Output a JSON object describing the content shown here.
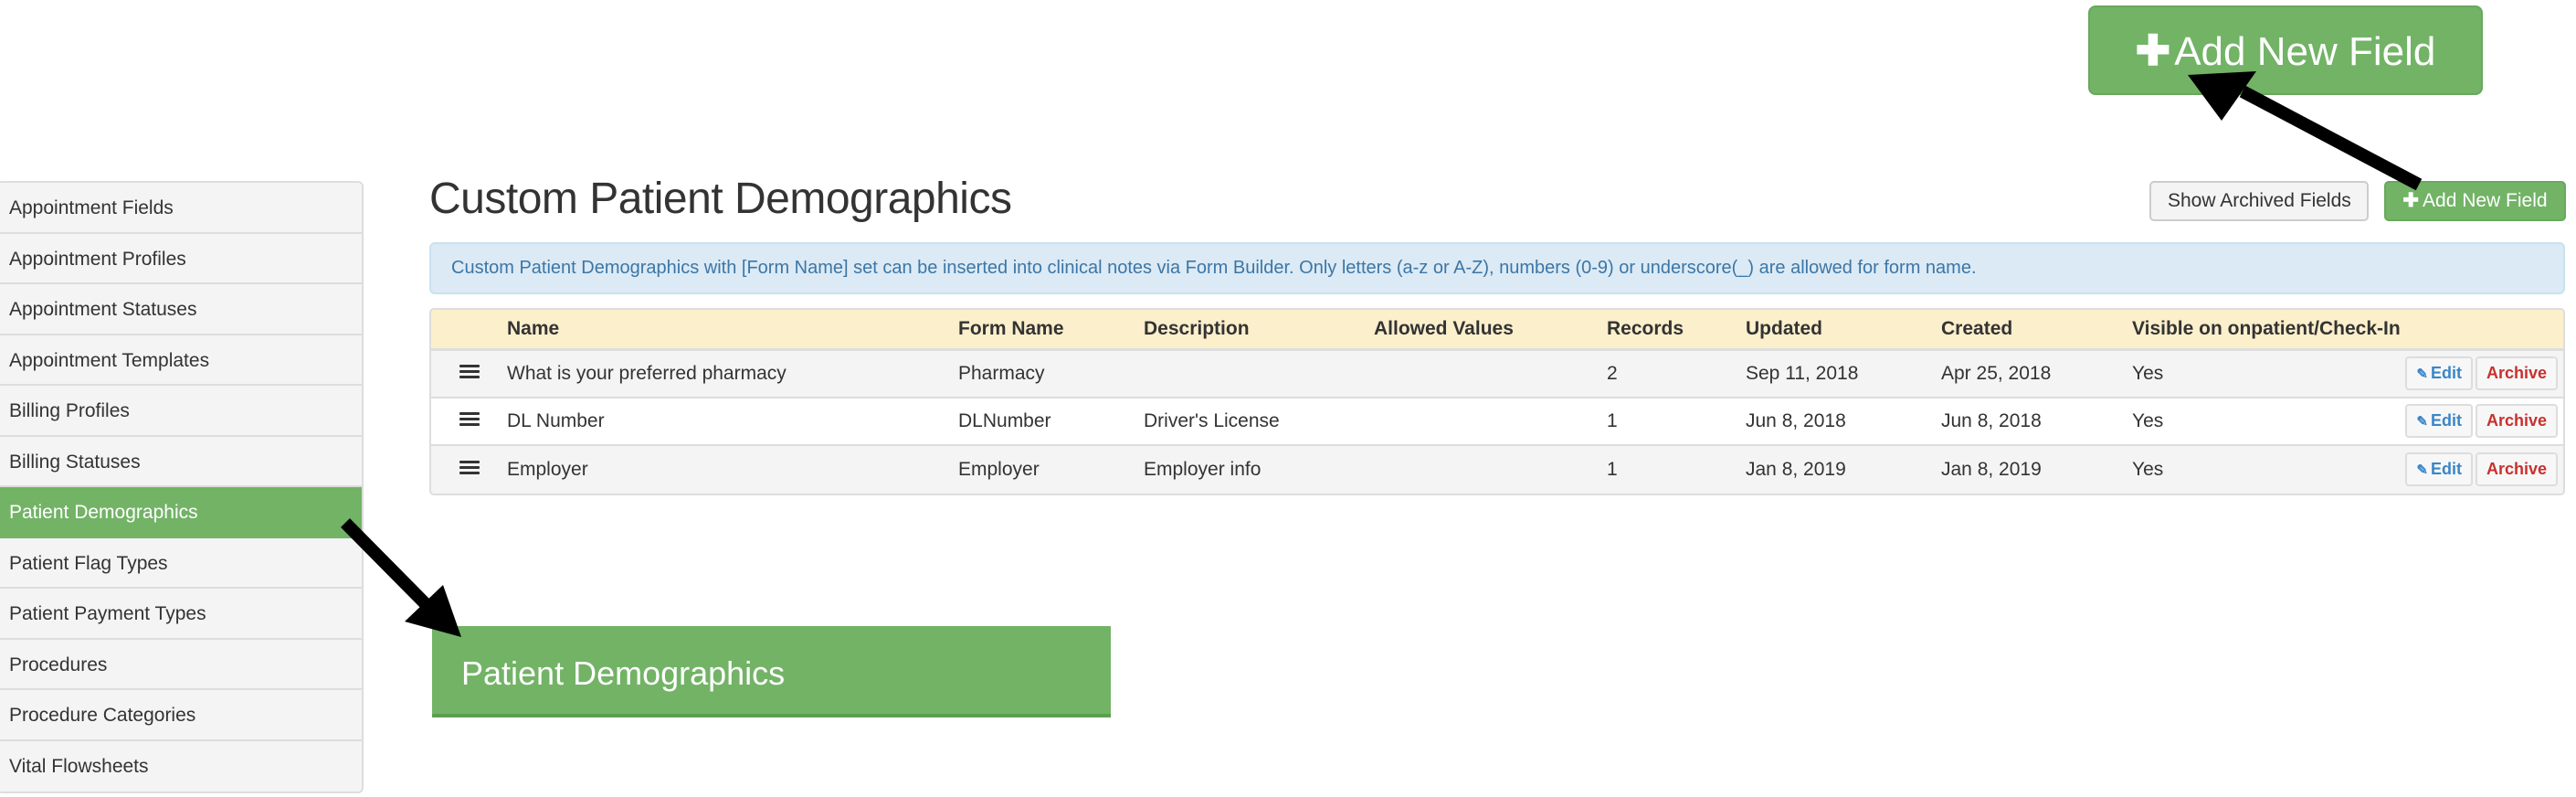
{
  "sidebar": {
    "items": [
      {
        "label": "Appointment Fields",
        "active": false
      },
      {
        "label": "Appointment Profiles",
        "active": false
      },
      {
        "label": "Appointment Statuses",
        "active": false
      },
      {
        "label": "Appointment Templates",
        "active": false
      },
      {
        "label": "Billing Profiles",
        "active": false
      },
      {
        "label": "Billing Statuses",
        "active": false
      },
      {
        "label": "Patient Demographics",
        "active": true
      },
      {
        "label": "Patient Flag Types",
        "active": false
      },
      {
        "label": "Patient Payment Types",
        "active": false
      },
      {
        "label": "Procedures",
        "active": false
      },
      {
        "label": "Procedure Categories",
        "active": false
      },
      {
        "label": "Vital Flowsheets",
        "active": false
      }
    ]
  },
  "header": {
    "title": "Custom Patient Demographics",
    "show_archived_label": "Show Archived Fields",
    "add_new_field_label": "Add New Field",
    "add_icon": "plus-icon"
  },
  "alert": {
    "text": "Custom Patient Demographics with [Form Name] set can be inserted into clinical notes via Form Builder. Only letters (a-z or A-Z), numbers (0-9) or underscore(_) are allowed for form name."
  },
  "table": {
    "columns": [
      "",
      "Name",
      "Form Name",
      "Description",
      "Allowed Values",
      "Records",
      "Updated",
      "Created",
      "Visible on onpatient/Check-In",
      ""
    ],
    "rows": [
      {
        "name": "What is your preferred pharmacy",
        "form_name": "Pharmacy",
        "description": "",
        "allowed_values": "",
        "records": "2",
        "updated": "Sep 11, 2018",
        "created": "Apr 25, 2018",
        "visible": "Yes"
      },
      {
        "name": "DL Number",
        "form_name": "DLNumber",
        "description": "Driver's License",
        "allowed_values": "",
        "records": "1",
        "updated": "Jun 8, 2018",
        "created": "Jun 8, 2018",
        "visible": "Yes"
      },
      {
        "name": "Employer",
        "form_name": "Employer",
        "description": "Employer info",
        "allowed_values": "",
        "records": "1",
        "updated": "Jan 8, 2019",
        "created": "Jan 8, 2019",
        "visible": "Yes"
      }
    ],
    "edit_label": "Edit",
    "archive_label": "Archive",
    "edit_icon": "pencil-icon",
    "handle_icon": "drag-handle-icon"
  },
  "callouts": {
    "add_new_field": "Add New Field",
    "patient_demographics": "Patient Demographics"
  },
  "colors": {
    "success": "#72b366",
    "alert_bg": "#dbeaf5",
    "alert_text": "#3c76a6",
    "table_header_bg": "#fcefcc",
    "edit_text": "#3a86c8",
    "archive_text": "#c9302c"
  }
}
